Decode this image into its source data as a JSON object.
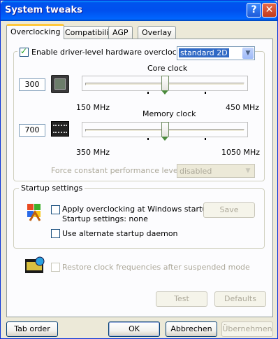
{
  "window": {
    "title": "System tweaks"
  },
  "tabs": [
    {
      "label": "Overclocking",
      "active": true
    },
    {
      "label": "Compatibility"
    },
    {
      "label": "AGP"
    },
    {
      "label": "Overlay"
    }
  ],
  "overclock": {
    "enable_label": "Enable driver-level hardware overclocking",
    "enable_checked": true,
    "mode_value": "standard 2D",
    "core": {
      "title": "Core clock",
      "value": "300",
      "min_label": "150 MHz",
      "max_label": "450 MHz",
      "level": 0.5
    },
    "memory": {
      "title": "Memory clock",
      "value": "700",
      "min_label": "350 MHz",
      "max_label": "1050 MHz",
      "level": 0.5
    },
    "force_label": "Force constant performance level",
    "force_value": "disabled"
  },
  "startup": {
    "group_label": "Startup settings",
    "apply_label": "Apply overclocking at Windows startup",
    "settings_label": "Startup settings: none",
    "save_label": "Save",
    "daemon_label": "Use alternate startup daemon"
  },
  "restore": {
    "label": "Restore clock frequencies after suspended mode"
  },
  "buttons": {
    "test": "Test",
    "defaults": "Defaults",
    "tab_order": "Tab order",
    "ok": "OK",
    "cancel": "Abbrechen",
    "apply": "Übernehmen"
  },
  "colors": {
    "titlebar": "#0053ee",
    "tab_highlight": "#ffc83c",
    "selection": "#316ac5"
  }
}
